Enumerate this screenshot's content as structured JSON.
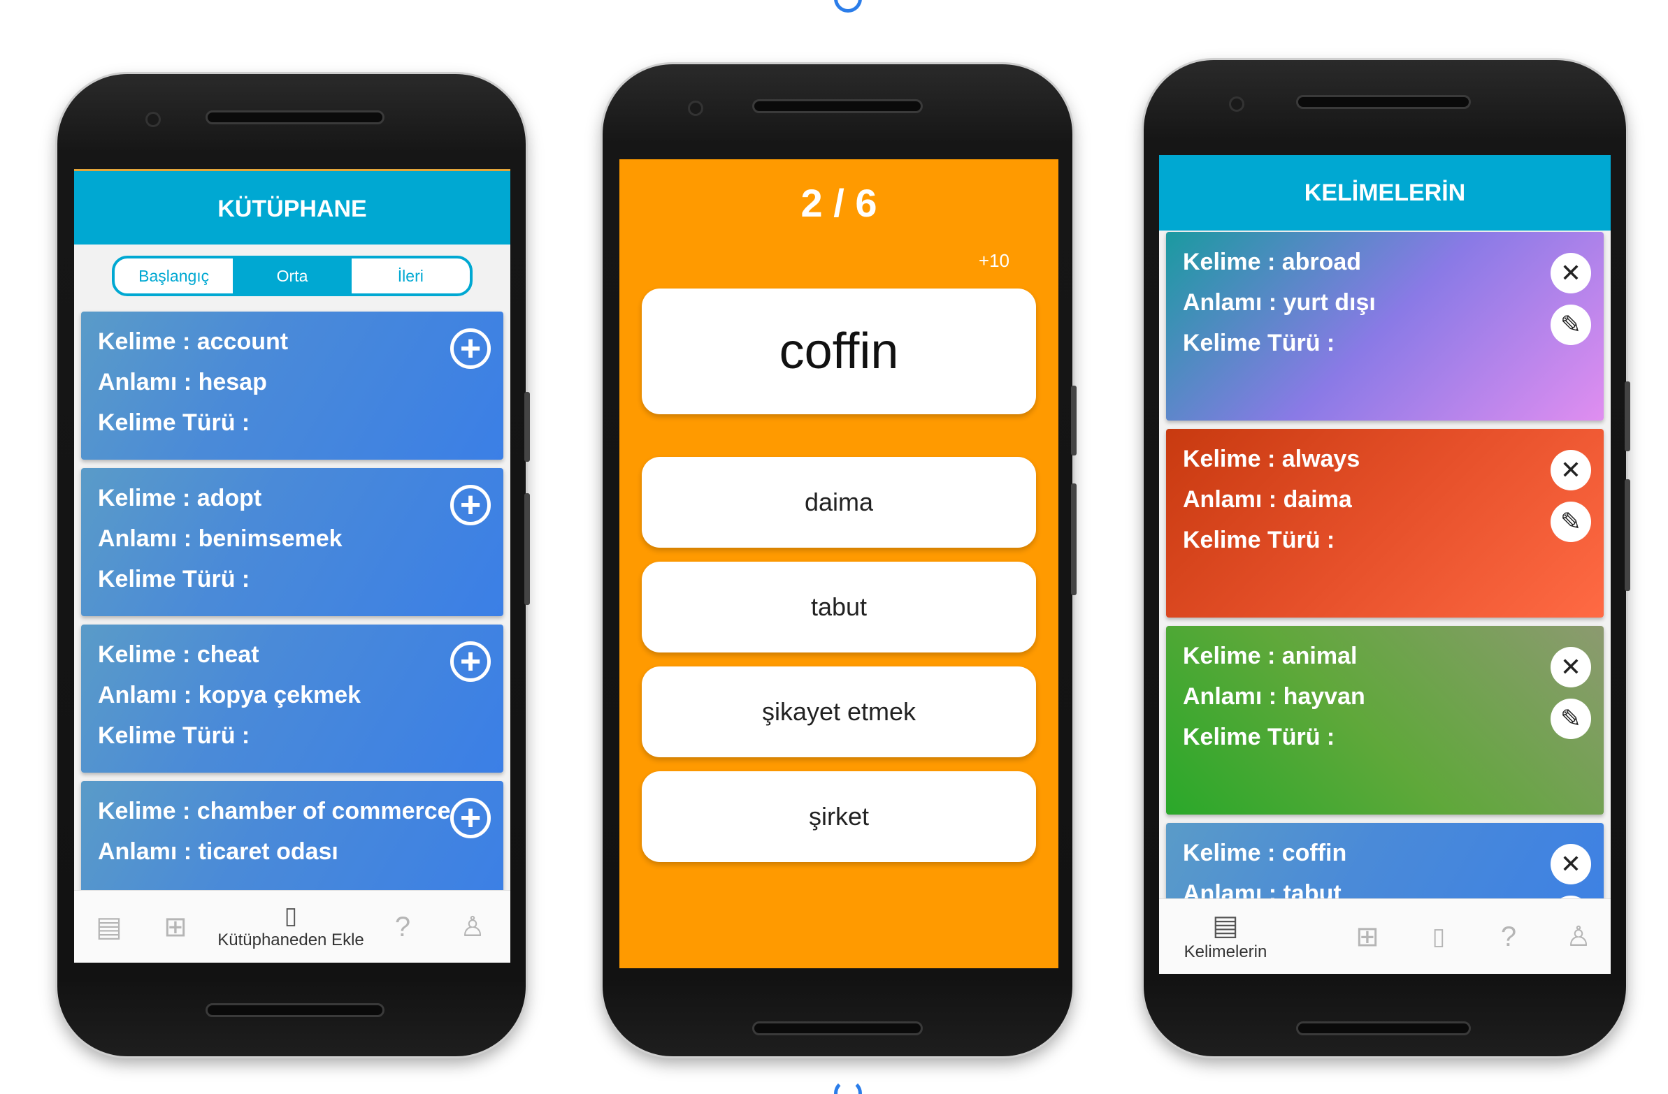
{
  "library_screen": {
    "header_title": "KÜTÜPHANE",
    "levels": [
      "Başlangıç",
      "Orta",
      "İleri"
    ],
    "active_level": "Orta",
    "cards": [
      {
        "word": "Kelime : account",
        "meaning": "Anlamı :  hesap",
        "type": "Kelime Türü :"
      },
      {
        "word": "Kelime : adopt",
        "meaning": "Anlamı :  benimsemek",
        "type": "Kelime Türü :"
      },
      {
        "word": "Kelime : cheat",
        "meaning": "Anlamı :  kopya çekmek",
        "type": "Kelime Türü :"
      },
      {
        "word": "Kelime : chamber of commerce",
        "meaning": "Anlamı :  ticaret odası",
        "type": ""
      }
    ],
    "nav": {
      "active_label": "Kütüphaneden Ekle"
    }
  },
  "quiz_screen": {
    "progress": "2 / 6",
    "score_delta": "+10",
    "question_word": "coffin",
    "options": [
      "daima",
      "tabut",
      "şikayet etmek",
      "şirket"
    ],
    "background_color": "#ff9a00"
  },
  "words_screen": {
    "header_title": "KELİMELERİN",
    "cards": [
      {
        "word": "Kelime : abroad",
        "meaning": "Anlamı :  yurt dışı",
        "type": "Kelime Türü :",
        "gradient": [
          "#1a9aa0",
          "#b07ce8",
          "#e08ef0"
        ]
      },
      {
        "word": "Kelime : always",
        "meaning": "Anlamı :  daima",
        "type": "Kelime Türü :",
        "gradient": [
          "#c83a10",
          "#e6502a",
          "#ff6a44"
        ]
      },
      {
        "word": "Kelime : animal",
        "meaning": "Anlamı :  hayvan",
        "type": "Kelime Türü :",
        "gradient": [
          "#36b030",
          "#5fa83a",
          "#8c9a70"
        ]
      },
      {
        "word": "Kelime : coffin",
        "meaning": "Anlamı :  tabut",
        "type": "",
        "gradient": [
          "#5a9bc8",
          "#4a8ad8",
          "#3b7fe6"
        ]
      }
    ],
    "nav": {
      "active_label": "Kelimelerin"
    }
  },
  "colors": {
    "header": "#00a8d2",
    "loader": "#2b7de9"
  }
}
